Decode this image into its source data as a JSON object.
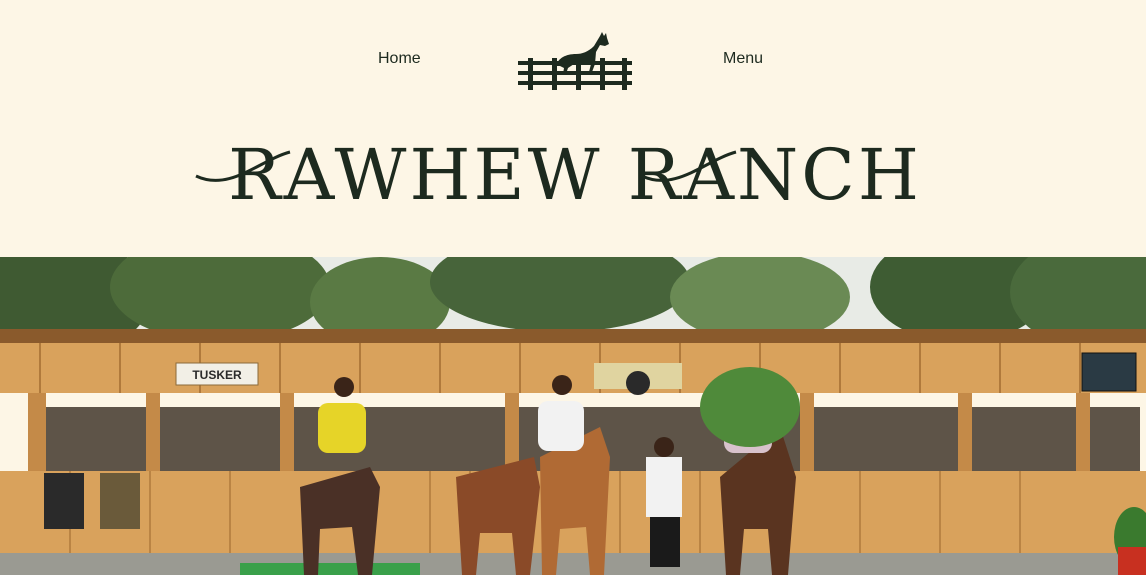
{
  "nav": {
    "home_label": "Home",
    "menu_label": "Menu"
  },
  "hero": {
    "title": "RAWHEW RANCH",
    "sign_label": "TUSKER"
  },
  "colors": {
    "background": "#fdf6e6",
    "ink": "#1d2a1f",
    "wood": "#d9a25c"
  },
  "icons": {
    "logo": "horse-over-fence-icon"
  }
}
